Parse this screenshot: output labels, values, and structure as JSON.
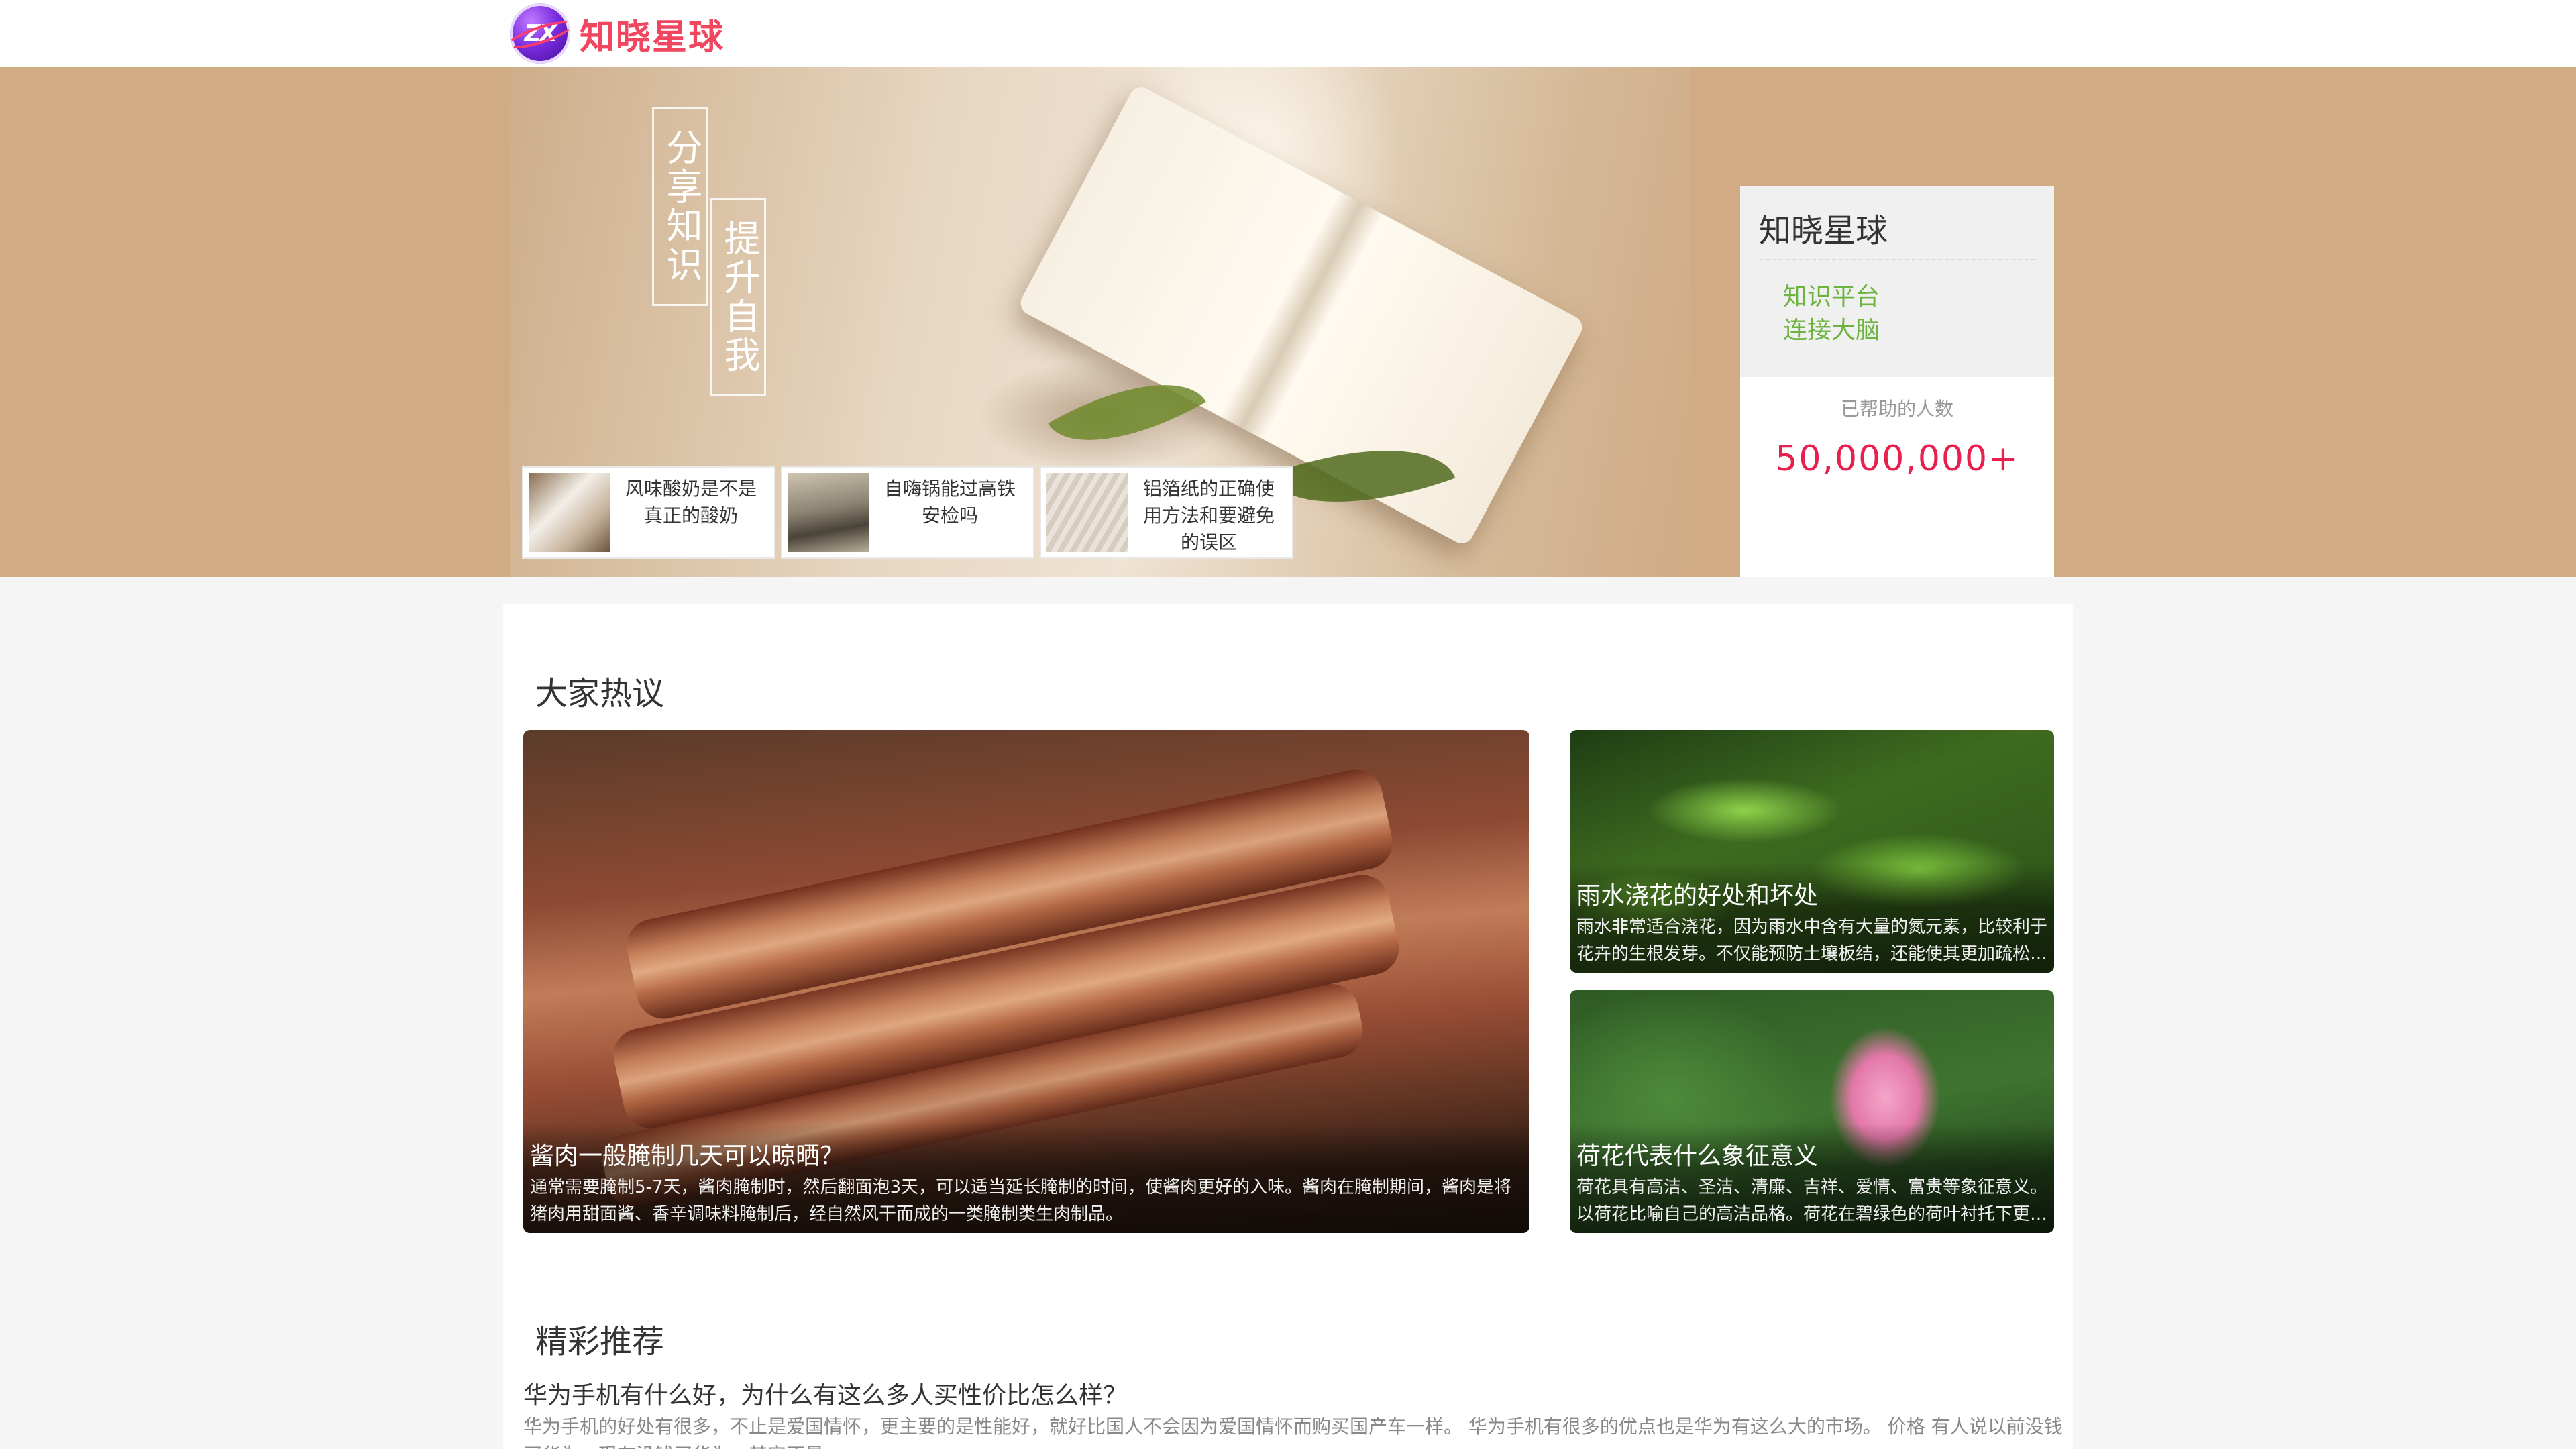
{
  "header": {
    "logo_mark": "ZX",
    "logo_text": "知晓星球"
  },
  "banner": {
    "slogan_1": "分享知识",
    "slogan_2": "提升自我",
    "mini_cards": [
      {
        "title": "风味酸奶是不是真正的酸奶",
        "thumb": "yogurt-photo"
      },
      {
        "title": "自嗨锅能过高铁安检吗",
        "thumb": "train-photo"
      },
      {
        "title": "铝箔纸的正确使用方法和要避免的误区",
        "thumb": "foil-photo"
      }
    ]
  },
  "side_card": {
    "title": "知晓星球",
    "line_1": "知识平台",
    "line_2": "连接大脑",
    "count_label": "已帮助的人数",
    "count_value": "50,000,000+"
  },
  "hot": {
    "section_title": "大家热议",
    "featured": {
      "title": "酱肉一般腌制几天可以晾晒？",
      "desc": "通常需要腌制5-7天，酱肉腌制时，然后翻面泡3天，可以适当延长腌制的时间，使酱肉更好的入味。酱肉在腌制期间，酱肉是将猪肉用甜面酱、香辛调味料腌制后，经自然风干而成的一类腌制类生肉制品。"
    },
    "items": [
      {
        "title": "雨水浇花的好处和坏处",
        "desc": "雨水非常适合浇花，因为雨水中含有大量的氮元素，比较利于花卉的生根发芽。不仅能预防土壤板结，还能使其更加疏松透气。"
      },
      {
        "title": "荷花代表什么象征意义",
        "desc": "荷花具有高洁、圣洁、清廉、吉祥、爱情、富贵等象征意义。以荷花比喻自己的高洁品格。荷花在碧绿色的荷叶衬托下更显清丽。"
      }
    ]
  },
  "recommend": {
    "section_title": "精彩推荐",
    "items": [
      {
        "title": "华为手机有什么好，为什么有这么多人买性价比怎么样？",
        "desc": "华为手机的好处有很多，不止是爱国情怀，更主要的是性能好，就好比国人不会因为爱国情怀而购买国产车一样。 华为手机有很多的优点也是华为有这么大的市场。 价格 有人说以前没钱买华为，现在没钱买华为，其实不是。"
      }
    ]
  },
  "colors": {
    "brand_red": "#f0465f",
    "accent_green": "#6db33f",
    "count_red": "#e8204e",
    "banner_bg": "#d0ab84"
  }
}
